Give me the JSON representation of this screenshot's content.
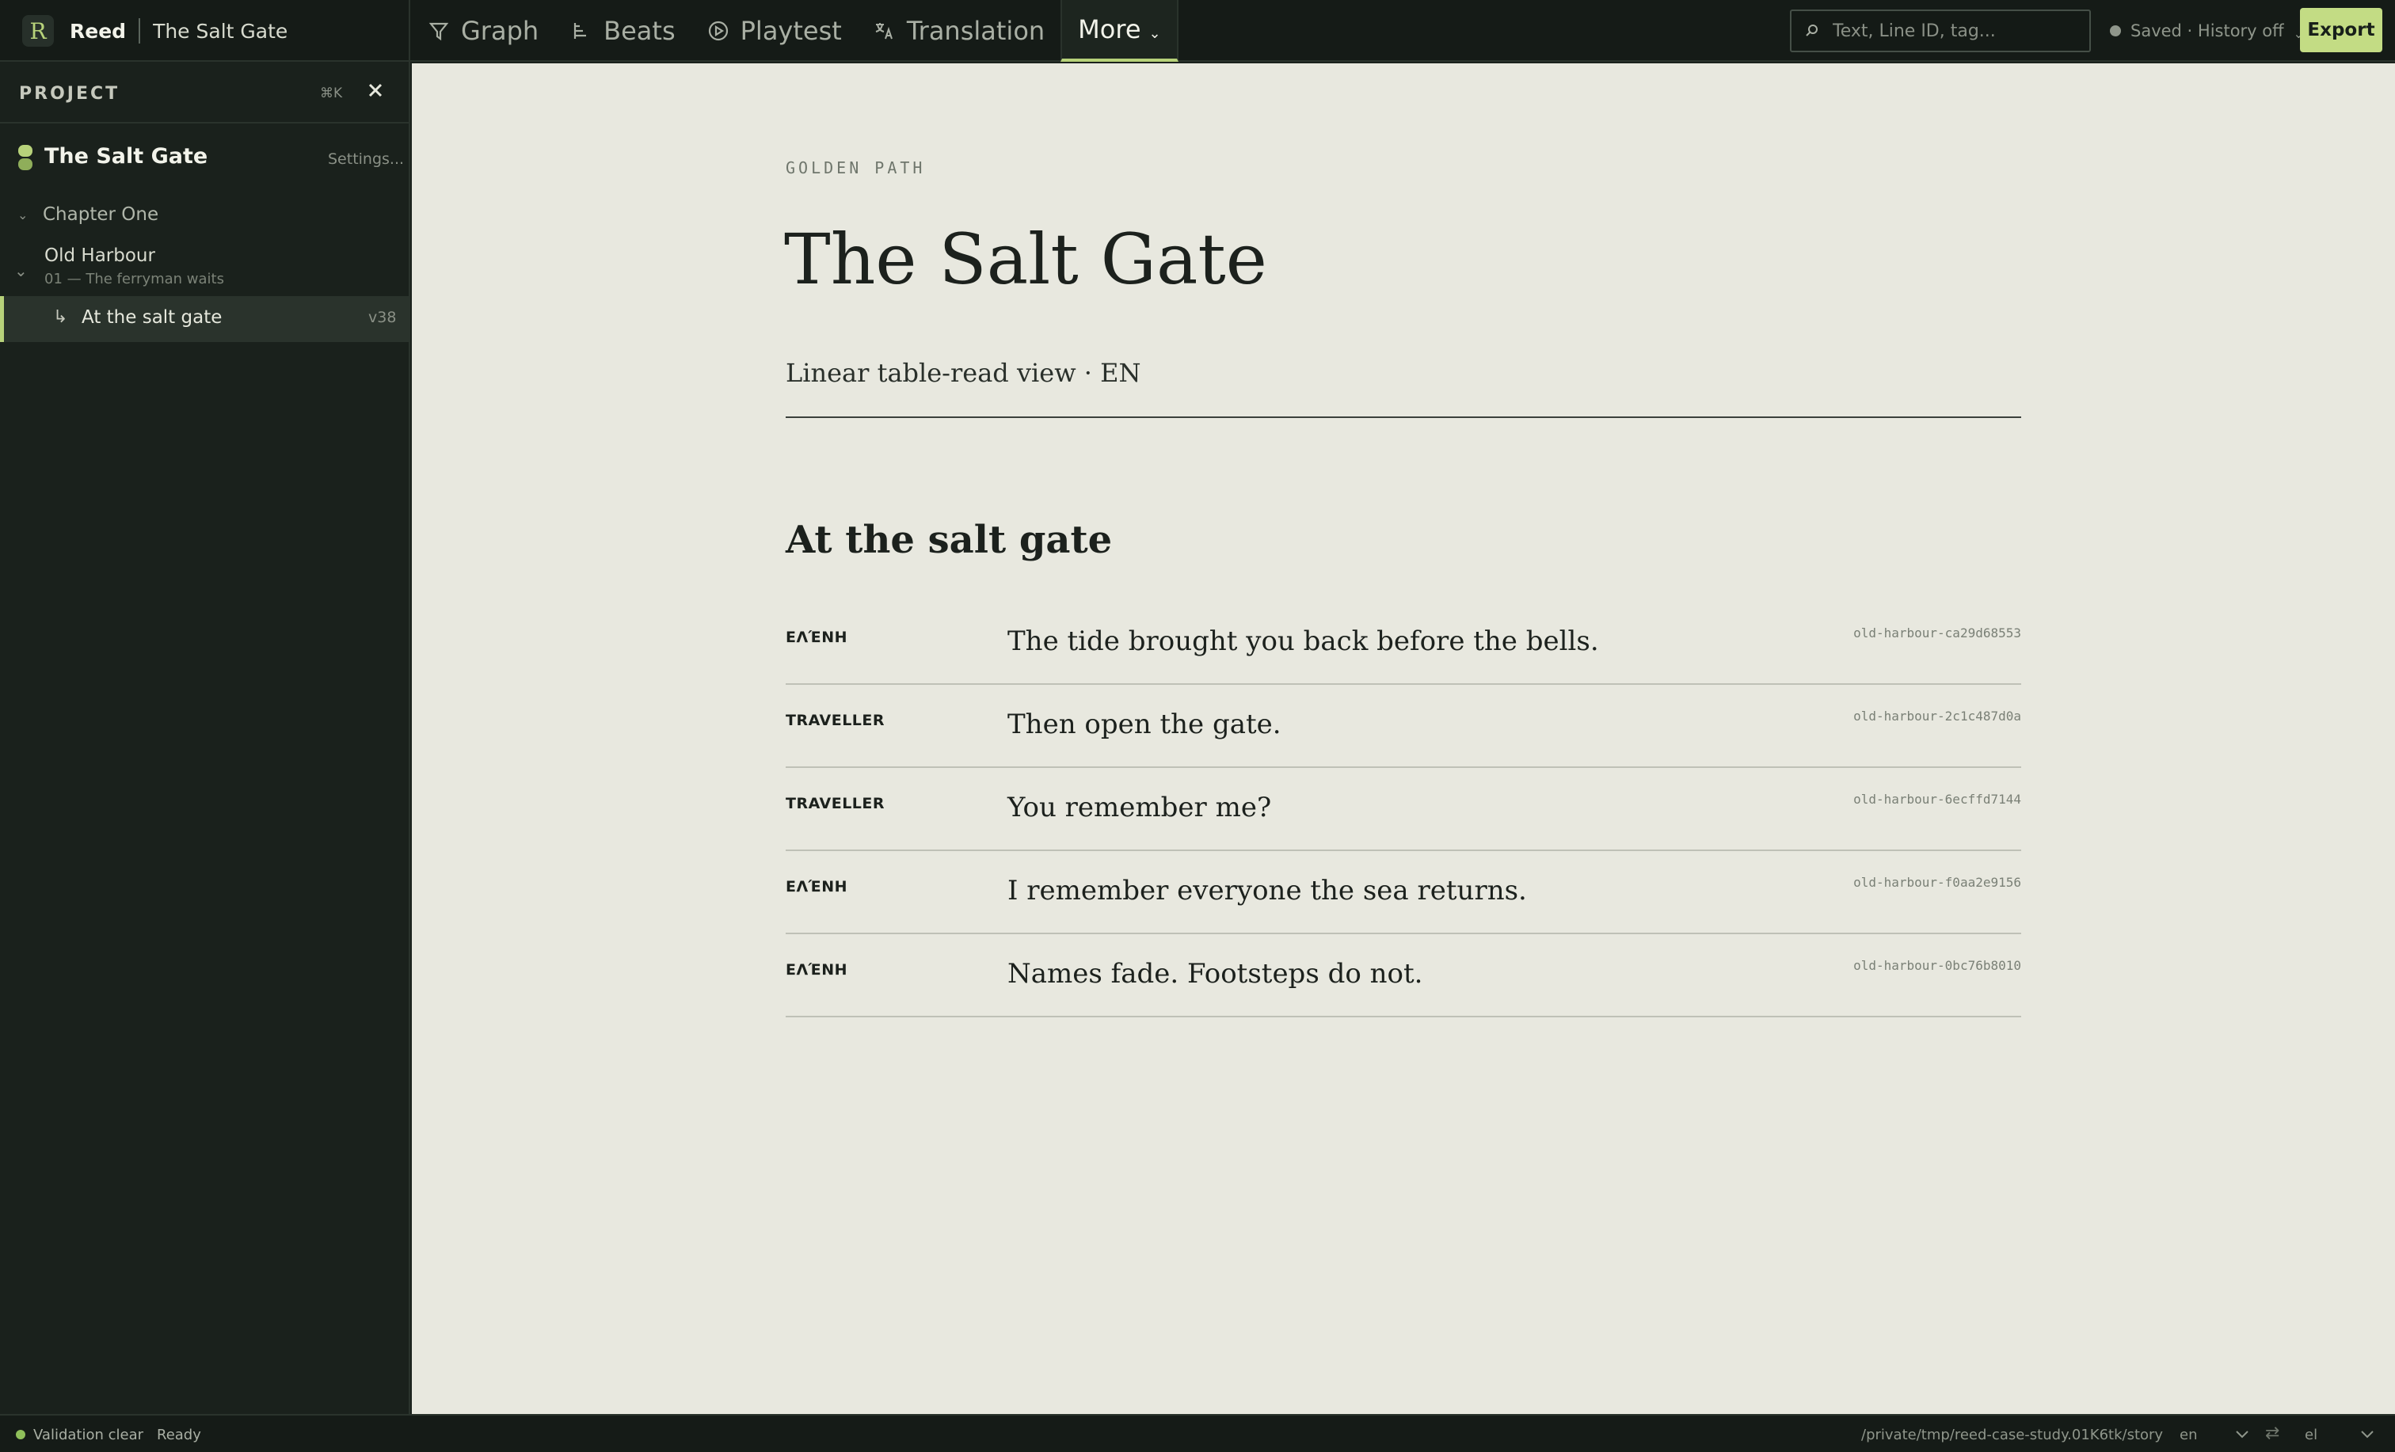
{
  "app": {
    "name": "Reed",
    "project_name": "The Salt Gate",
    "logo_glyph": "R"
  },
  "tabs": [
    {
      "label": "Graph",
      "icon": "graph-icon"
    },
    {
      "label": "Beats",
      "icon": "beats-icon"
    },
    {
      "label": "Playtest",
      "icon": "play-icon"
    },
    {
      "label": "Translation",
      "icon": "translate-icon"
    },
    {
      "label": "More",
      "icon": "chevron-down-icon",
      "active": true
    }
  ],
  "search": {
    "placeholder": "Text, Line ID, tag..."
  },
  "save_status": {
    "label": "Saved · History off"
  },
  "export_label": "Export",
  "sidebar": {
    "title": "PROJECT",
    "shortcut": "⌘K",
    "project": {
      "name": "The Salt Gate",
      "settings_label": "Settings..."
    },
    "chapter": {
      "label": "Chapter One"
    },
    "section": {
      "label": "Old Harbour",
      "sub": "01 — The ferryman waits"
    },
    "node": {
      "label": "At the salt gate",
      "version": "v38"
    }
  },
  "document": {
    "eyebrow": "GOLDEN PATH",
    "title": "The Salt Gate",
    "subtitle": "Linear table-read view · EN",
    "scene_title": "At the salt gate",
    "lines": [
      {
        "speaker": "ΕΛΈΝΗ",
        "text": "The tide brought you back before the bells.",
        "id": "old-harbour-ca29d68553"
      },
      {
        "speaker": "TRAVELLER",
        "text": "Then open the gate.",
        "id": "old-harbour-2c1c487d0a"
      },
      {
        "speaker": "TRAVELLER",
        "text": "You remember me?",
        "id": "old-harbour-6ecffd7144"
      },
      {
        "speaker": "ΕΛΈΝΗ",
        "text": "I remember everyone the sea returns.",
        "id": "old-harbour-f0aa2e9156"
      },
      {
        "speaker": "ΕΛΈΝΗ",
        "text": "Names fade. Footsteps do not.",
        "id": "old-harbour-0bc76b8010"
      }
    ]
  },
  "status_bar": {
    "validation": "Validation clear",
    "state": "Ready",
    "path": "/private/tmp/reed-case-study.01K6tk/story",
    "source_lang": "en",
    "swap_glyph": "⇄",
    "target_lang": "el"
  },
  "colors": {
    "accent": "#b7d27a",
    "export_bg": "#c3dc84",
    "page_bg": "#e8e8df",
    "chrome_bg": "#151b17"
  }
}
